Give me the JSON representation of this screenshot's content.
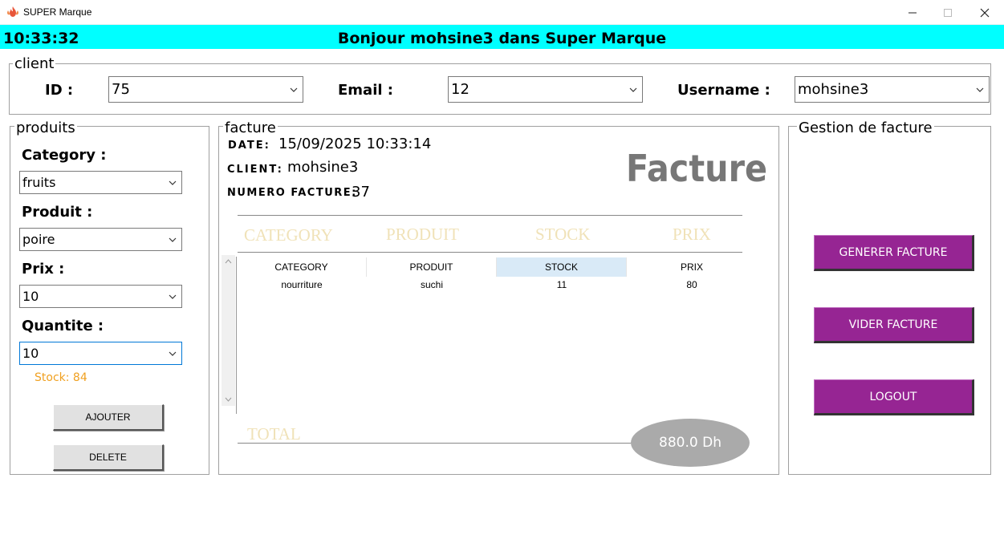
{
  "window": {
    "title": "SUPER Marque",
    "logo_icon": "flame-logo-icon",
    "accent": "#00ffff"
  },
  "header": {
    "clock": "10:33:32",
    "greeting": "Bonjour mohsine3 dans Super Marque"
  },
  "client": {
    "title": "client",
    "id_label": "ID :",
    "id_value": "75",
    "email_label": "Email :",
    "email_value": "12",
    "username_label": "Username :",
    "username_value": "mohsine3"
  },
  "produits": {
    "title": "produits",
    "category_label": "Category :",
    "category_value": "fruits",
    "produit_label": "Produit :",
    "produit_value": "poire",
    "prix_label": "Prix :",
    "prix_value": "10",
    "quantite_label": "Quantite :",
    "quantite_value": "10",
    "stock_text": "Stock: 84",
    "stock_color": "#f0a020",
    "ajouter_label": "AJOUTER",
    "delete_label": "DELETE"
  },
  "facture": {
    "title": "facture",
    "date_label": "DATE:",
    "date_value": "15/09/2025 10:33:14",
    "client_label": "CLIENT:",
    "client_value": "mohsine3",
    "numero_label": "NUMERO FACTURE:",
    "numero_value": "37",
    "big_title": "Facture",
    "ghost_headers": [
      "CATEGORY",
      "PRODUIT",
      "STOCK",
      "PRIX"
    ],
    "table": {
      "columns": [
        "CATEGORY",
        "PRODUIT",
        "STOCK",
        "PRIX"
      ],
      "rows": [
        [
          "nourriture",
          "suchi",
          "11",
          "80"
        ]
      ]
    },
    "total_label": "TOTAL",
    "total_value": "880.0 Dh"
  },
  "gestion": {
    "title": "Gestion de facture",
    "generer_label": "GENERER FACTURE",
    "vider_label": "VIDER FACTURE",
    "logout_label": "LOGOUT",
    "button_color": "#962593"
  }
}
